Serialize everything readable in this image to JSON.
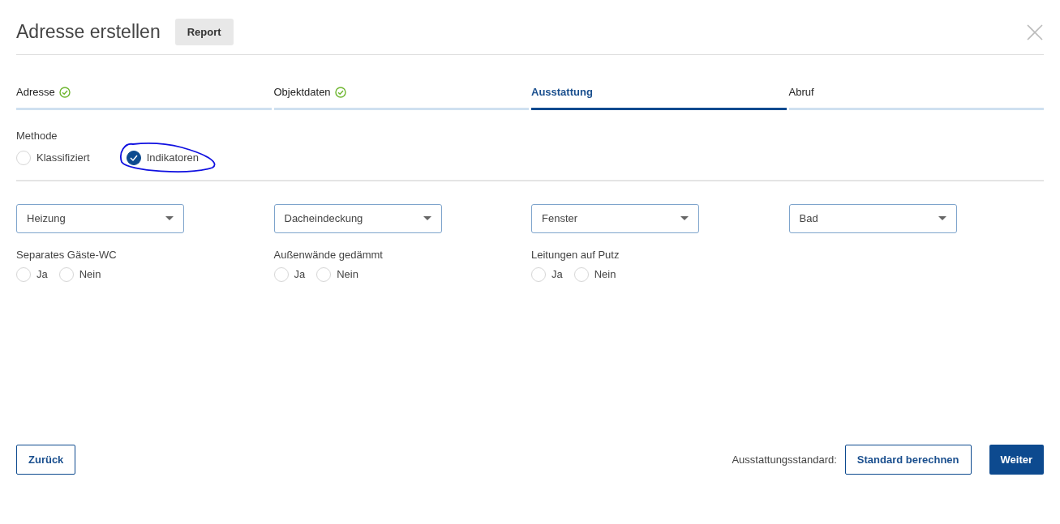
{
  "title": "Adresse erstellen",
  "report_button": "Report",
  "steps": [
    {
      "label": "Adresse",
      "done": true,
      "selected": false
    },
    {
      "label": "Objektdaten",
      "done": true,
      "selected": false
    },
    {
      "label": "Ausstattung",
      "done": false,
      "selected": true
    },
    {
      "label": "Abruf",
      "done": false,
      "selected": false
    }
  ],
  "method": {
    "label": "Methode",
    "options": [
      {
        "label": "Klassifiziert",
        "selected": false,
        "annotated": false
      },
      {
        "label": "Indikatoren",
        "selected": true,
        "annotated": true
      }
    ]
  },
  "dropdowns": [
    {
      "placeholder": "Heizung"
    },
    {
      "placeholder": "Dacheindeckung"
    },
    {
      "placeholder": "Fenster"
    },
    {
      "placeholder": "Bad"
    }
  ],
  "questions": [
    {
      "label": "Separates Gäste-WC",
      "options": [
        {
          "label": "Ja",
          "selected": false
        },
        {
          "label": "Nein",
          "selected": false
        }
      ]
    },
    {
      "label": "Außenwände gedämmt",
      "options": [
        {
          "label": "Ja",
          "selected": false
        },
        {
          "label": "Nein",
          "selected": false
        }
      ]
    },
    {
      "label": "Leitungen auf Putz",
      "options": [
        {
          "label": "Ja",
          "selected": false
        },
        {
          "label": "Nein",
          "selected": false
        }
      ]
    }
  ],
  "footer": {
    "back_button": "Zurück",
    "standard_label": "Ausstattungsstandard:",
    "calculate_button": "Standard berechnen",
    "next_button": "Weiter"
  }
}
